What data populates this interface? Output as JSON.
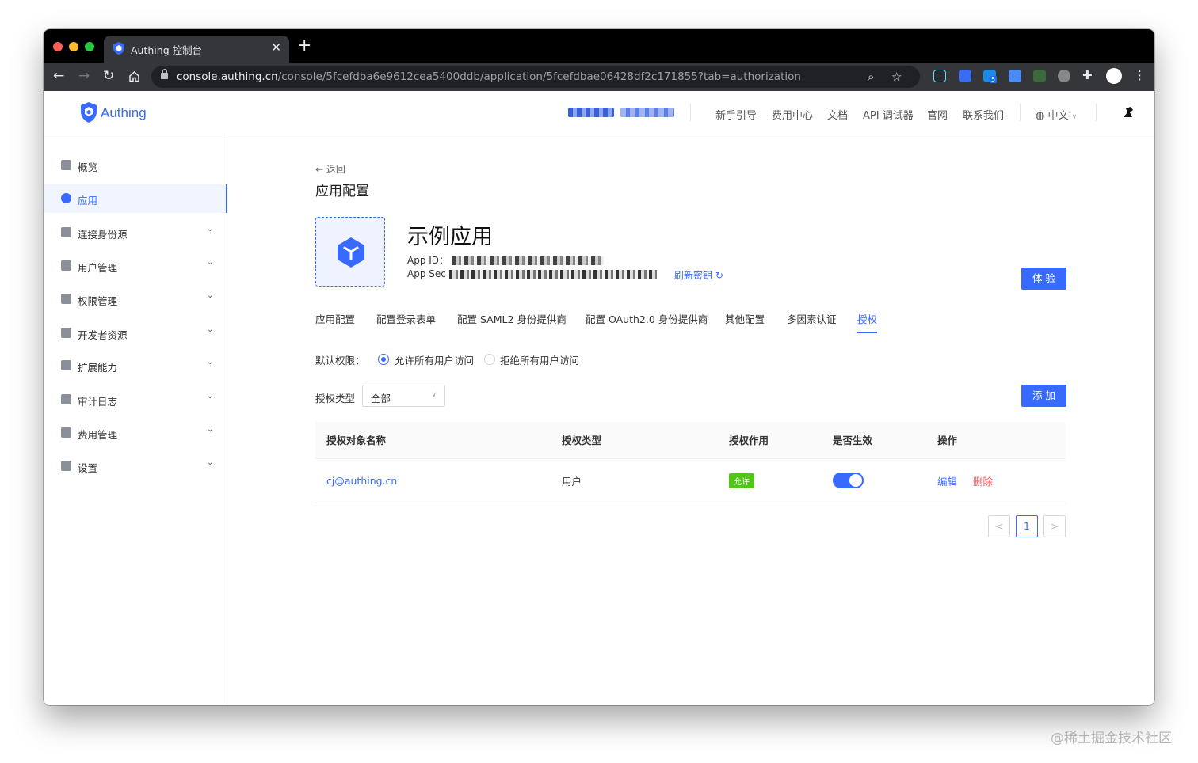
{
  "browser": {
    "tab_title": "Authing 控制台",
    "url_host": "console.authing.cn",
    "url_path": "/console/5fcefdba6e9612cea5400ddb/application/5fcefdbae06428df2c171855?tab=authorization",
    "ext_badge": "5"
  },
  "header": {
    "logo_text": "Authing",
    "nav": [
      "新手引导",
      "费用中心",
      "文档",
      "API 调试器",
      "官网",
      "联系我们"
    ],
    "language": "中文"
  },
  "sidebar": {
    "items": [
      {
        "label": "概览",
        "icon": "dashboard-icon",
        "expandable": false
      },
      {
        "label": "应用",
        "icon": "app-icon",
        "expandable": false,
        "active": true
      },
      {
        "label": "连接身份源",
        "icon": "id-card-icon",
        "expandable": true
      },
      {
        "label": "用户管理",
        "icon": "user-icon",
        "expandable": true
      },
      {
        "label": "权限管理",
        "icon": "shield-icon",
        "expandable": true
      },
      {
        "label": "开发者资源",
        "icon": "code-icon",
        "expandable": true
      },
      {
        "label": "扩展能力",
        "icon": "extension-icon",
        "expandable": true
      },
      {
        "label": "审计日志",
        "icon": "log-icon",
        "expandable": true
      },
      {
        "label": "费用管理",
        "icon": "billing-icon",
        "expandable": true
      },
      {
        "label": "设置",
        "icon": "gear-icon",
        "expandable": true
      }
    ]
  },
  "main": {
    "back_label": "返回",
    "page_title": "应用配置",
    "app_name": "示例应用",
    "app_id_label": "App ID：",
    "app_secret_label": "App Sec",
    "refresh_label": "刷新密钥",
    "try_button": "体 验",
    "tabs": [
      "应用配置",
      "配置登录表单",
      "配置 SAML2 身份提供商",
      "配置 OAuth2.0 身份提供商",
      "其他配置",
      "多因素认证",
      "授权"
    ],
    "active_tab": 6,
    "default_perm_label": "默认权限：",
    "radio_options": [
      "允许所有用户访问",
      "拒绝所有用户访问"
    ],
    "radio_selected": 0,
    "type_label": "授权类型",
    "type_value": "全部",
    "add_button": "添 加",
    "table": {
      "columns": [
        "授权对象名称",
        "授权类型",
        "授权作用",
        "是否生效",
        "操作"
      ],
      "rows": [
        {
          "name": "cj@authing.cn",
          "type": "用户",
          "effect": "允许",
          "enabled": true,
          "edit": "编辑",
          "delete": "删除"
        }
      ]
    },
    "pagination": {
      "prev": "<",
      "current": "1",
      "next": ">"
    }
  },
  "watermark": "@稀土掘金技术社区",
  "colors": {
    "accent": "#396aff",
    "allow": "#52c41a",
    "danger": "#ff4d4f"
  }
}
